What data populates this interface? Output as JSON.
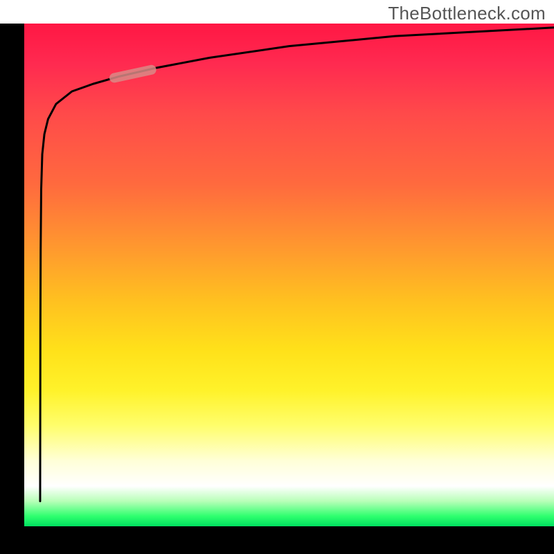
{
  "watermark": "TheBottleneck.com",
  "chart_data": {
    "type": "line",
    "title": "",
    "xlabel": "",
    "ylabel": "",
    "xlim": [
      0,
      100
    ],
    "ylim": [
      0,
      100
    ],
    "grid": false,
    "legend": false,
    "annotations": [],
    "note": "Axes are unlabeled; values below are estimated as percentages of the inner plot area (0–100). The primary series is a steep curve that rises almost vertically near x≈3 from y≈5 to y≈88, then flattens out approaching y≈99 at the right edge. A short secondary highlight segment overlays the curve near x≈17–24.",
    "series": [
      {
        "name": "curve",
        "color": "#000000",
        "x": [
          3.0,
          3.02,
          3.05,
          3.1,
          3.2,
          3.4,
          3.8,
          4.5,
          6.0,
          9.0,
          13.0,
          18.0,
          25.0,
          35.0,
          50.0,
          70.0,
          100.0
        ],
        "values": [
          5.0,
          20.0,
          40.0,
          55.0,
          67.0,
          74.0,
          78.0,
          81.0,
          84.0,
          86.5,
          88.0,
          89.5,
          91.2,
          93.2,
          95.5,
          97.5,
          99.2
        ]
      },
      {
        "name": "highlight-segment",
        "color": "#d98a86",
        "x": [
          17.0,
          24.0
        ],
        "values": [
          89.2,
          90.8
        ]
      }
    ]
  }
}
